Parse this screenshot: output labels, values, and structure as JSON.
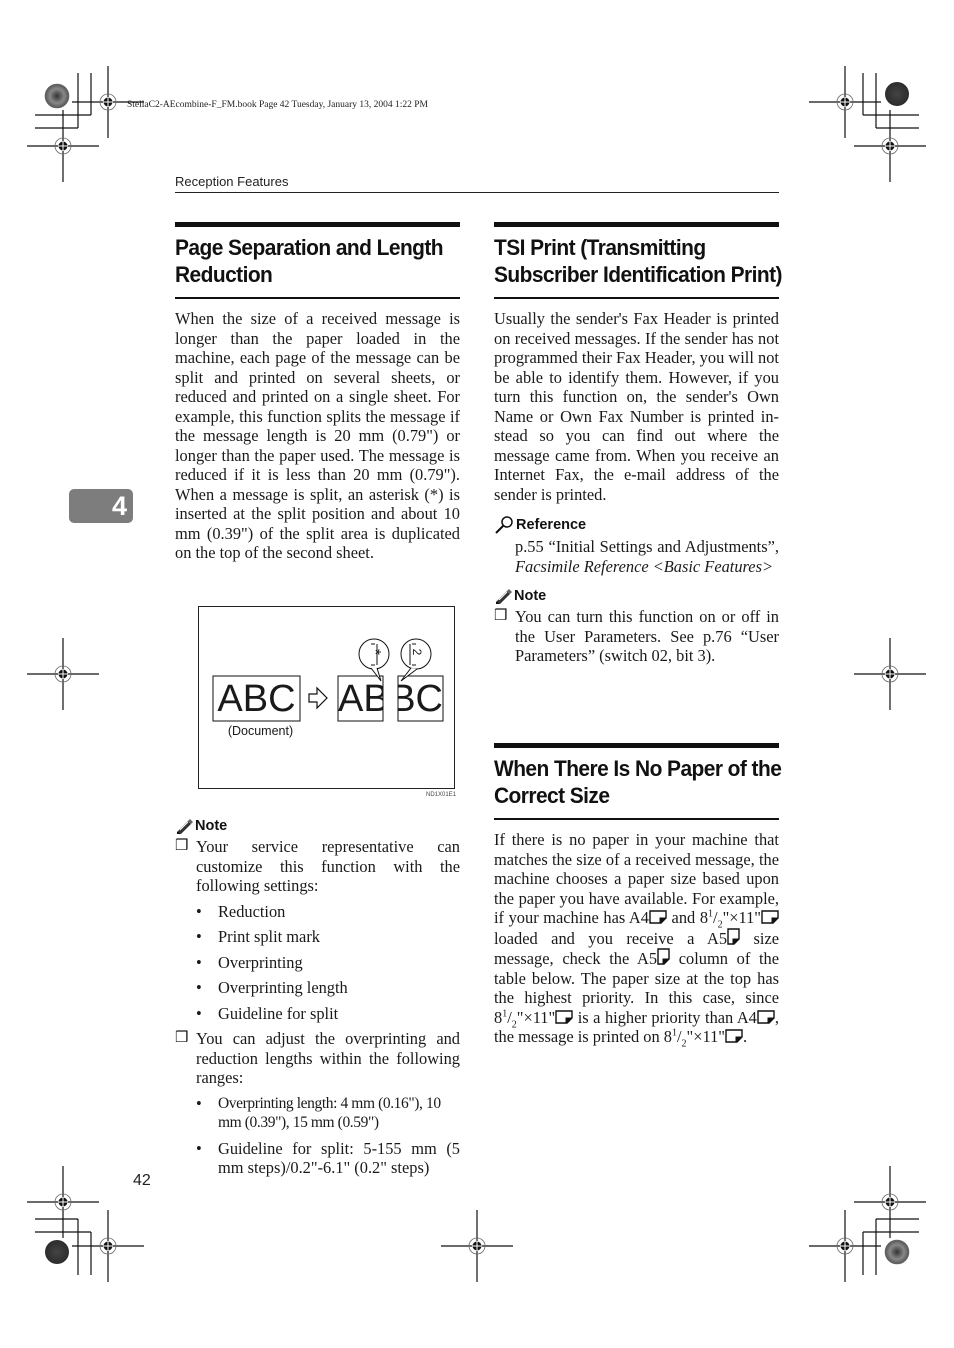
{
  "print_header": {
    "book_info": "StellaC2-AEcombine-F_FM.book  Page 42  Tuesday, January 13, 2004  1:22 PM"
  },
  "running_head": "Reception Features",
  "chapter_tab": "4",
  "page_number": "42",
  "left_column": {
    "section_title_line1": "Page Separation and Length",
    "section_title_line2": "Reduction",
    "body": "When the size of a received message is longer than the paper loaded in the machine, each page of the message can be split and printed on several sheets, or reduced and printed on a single sheet. For example, this func­tion splits the message if the message length is 20 mm (0.79\") or longer than the paper used. The message is re­duced if it is less than 20 mm (0.79\"). When a message is split, an asterisk (*) is inserted at the split position and about 10 mm (0.39\") of the split area is duplicated on the top of the second sheet.",
    "figure": {
      "document_text": "ABC",
      "document_caption": "(Document)",
      "split_part1_text": "AB",
      "split_part2_text": "BC",
      "split_mark_1": "*",
      "split_mark_2": "2",
      "figure_code": "ND1X01E1"
    },
    "note": {
      "label": "Note",
      "items": [
        {
          "text": "Your service representative can customize this function with the following settings:",
          "bullets": [
            "Reduction",
            "Print split mark",
            "Overprinting",
            "Overprinting length",
            "Guideline for split"
          ]
        },
        {
          "text": "You can adjust the overprinting and reduction lengths within the following ranges:",
          "bullets": [
            "Overprinting length: 4 mm (0.16\"), 10 mm (0.39\"), 15 mm (0.59\")",
            "Guideline for split: 5-155 mm (5 mm steps)/0.2\"-6.1\" (0.2\" steps)"
          ]
        }
      ]
    }
  },
  "right_column": {
    "section1": {
      "title_line1": "TSI Print (Transmitting",
      "title_line2": "Subscriber Identification Print)",
      "body": "Usually the sender's Fax Header is printed on received messages. If the sender has not programmed their Fax Header, you will not be able to identi­fy them. However, if you turn this function on, the sender's Own Name or Own Fax Number is printed in­stead so you can find out where the message came from. When you re­ceive an Internet Fax, the e-mail ad­dress of the sender is printed.",
      "reference": {
        "label": "Reference",
        "text_prefix": "p.55 “Initial Settings and Adjust­ments”, ",
        "text_italic": "Facsimile Reference <Basic Features>"
      },
      "note": {
        "label": "Note",
        "items": [
          "You can turn this function on or off in the User Parameters. See p.76 “User Parameters” (switch 02, bit 3)."
        ]
      }
    },
    "section2": {
      "title_line1": "When There Is No Paper of the",
      "title_line2": "Correct Size",
      "body_parts": {
        "p1": "If there is no paper in your machine that matches the size of a received message, the machine chooses a pa­per size based upon the paper you have available. For example, if your machine has A4",
        "p2": " and 8",
        "p3": "\"×11\"",
        "p4": " loaded and you receive a A5",
        "p5": " size message, check the A5",
        "p6": " column of the table below. The paper size at the top has the highest priority. In this case, since 8",
        "p7": "\"×11\"",
        "p8": " is a higher pri­ority than A4",
        "p9": ", the message is print­ed on 8",
        "p10": "\"×11\"",
        "p11": ".",
        "frac_num": "1",
        "frac_den": "2"
      }
    }
  }
}
